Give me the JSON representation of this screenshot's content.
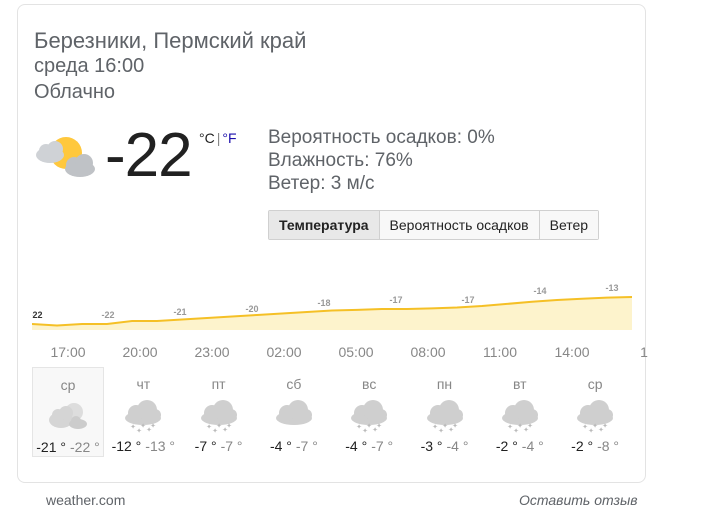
{
  "location": "Березники, Пермский край",
  "datetime": "среда 16:00",
  "condition": "Облачно",
  "current": {
    "icon": "partly-cloudy-icon",
    "temperature": "-22",
    "unit_c": "°C",
    "unit_sep": "|",
    "unit_f": "°F",
    "precipitation": "Вероятность осадков: 0%",
    "humidity": "Влажность: 76%",
    "wind": "Ветер: 3 м/с"
  },
  "tabs": [
    {
      "label": "Температура",
      "active": true
    },
    {
      "label": "Вероятность осадков",
      "active": false
    },
    {
      "label": "Ветер",
      "active": false
    }
  ],
  "chart_data": {
    "type": "area",
    "title": "",
    "series": [
      {
        "values": [
          -22,
          -22,
          -21,
          -20,
          -18,
          -17,
          -17,
          -14,
          -13
        ]
      }
    ],
    "curve": [
      -22,
      -22.5,
      -22,
      -22,
      -21,
      -21,
      -20.5,
      -20,
      -19.5,
      -19,
      -18.5,
      -18,
      -17.5,
      -17.3,
      -17,
      -17,
      -16.8,
      -16.5,
      -16,
      -15.3,
      -14.6,
      -14,
      -13.6,
      -13.2,
      -13
    ],
    "labels": [
      "-22",
      "-22",
      "-21",
      "-20",
      "-18",
      "-17",
      "-17",
      "-14",
      "-13"
    ],
    "x": [
      "17:00",
      "20:00",
      "23:00",
      "02:00",
      "05:00",
      "08:00",
      "11:00",
      "14:00",
      "1"
    ],
    "line_color": "#f5c026",
    "fill_color": "#fdf3cc"
  },
  "days": [
    {
      "name": "ср",
      "hi": "-21 °",
      "lo": "-22 °",
      "icon": "partly-cloudy-icon",
      "selected": true
    },
    {
      "name": "чт",
      "hi": "-12 °",
      "lo": "-13 °",
      "icon": "snow-icon",
      "selected": false
    },
    {
      "name": "пт",
      "hi": "-7 °",
      "lo": "-7 °",
      "icon": "snow-icon",
      "selected": false
    },
    {
      "name": "сб",
      "hi": "-4 °",
      "lo": "-7 °",
      "icon": "cloudy-icon",
      "selected": false
    },
    {
      "name": "вс",
      "hi": "-4 °",
      "lo": "-7 °",
      "icon": "snow-icon",
      "selected": false
    },
    {
      "name": "пн",
      "hi": "-3 °",
      "lo": "-4 °",
      "icon": "snow-icon",
      "selected": false
    },
    {
      "name": "вт",
      "hi": "-2 °",
      "lo": "-4 °",
      "icon": "snow-icon",
      "selected": false
    },
    {
      "name": "ср",
      "hi": "-2 °",
      "lo": "-8 °",
      "icon": "snow-icon",
      "selected": false
    }
  ],
  "footer": {
    "source": "weather.com",
    "feedback": "Оставить отзыв"
  }
}
